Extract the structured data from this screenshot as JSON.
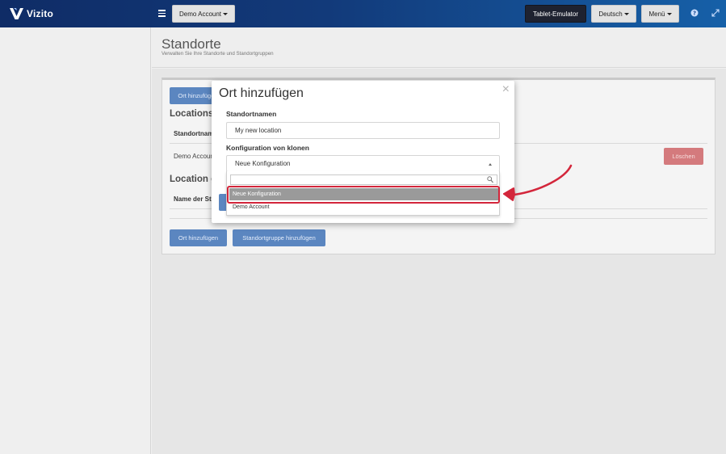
{
  "app": {
    "brand": "Vizito"
  },
  "topbar": {
    "account_label": "Demo Account",
    "tablet_emulator_label": "Tablet-Emulator",
    "language_label": "Deutsch",
    "menu_label": "Menü"
  },
  "page": {
    "title": "Standorte",
    "subtitle": "Verwalten Sie Ihre Standorte und Standortgruppen"
  },
  "locations": {
    "add_button": "Ort hinzufügen",
    "heading": "Locations",
    "column_name": "Standortnam",
    "row_name": "Demo Accoun",
    "delete_button": "Löschen"
  },
  "location_groups": {
    "heading": "Location gr",
    "column_name": "Name der Sta",
    "add_location_button": "Ort hinzufügen",
    "add_group_button": "Standortgruppe hinzufügen"
  },
  "modal": {
    "title": "Ort hinzufügen",
    "name_label": "Standortnamen",
    "name_value": "My new location",
    "clone_label": "Konfiguration von klonen",
    "clone_selected": "Neue Konfiguration",
    "options": [
      "Neue Konfiguration",
      "Demo Account"
    ]
  },
  "colors": {
    "topbar_start": "#0f2c66",
    "topbar_end": "#1660a8",
    "primary_button": "#5b86c0",
    "danger_button": "#d47a7d",
    "annotation_red": "#d3263b"
  },
  "icons": [
    "hamburger-icon",
    "help-icon",
    "fullscreen-icon",
    "close-icon",
    "search-icon",
    "caret-down-icon"
  ]
}
